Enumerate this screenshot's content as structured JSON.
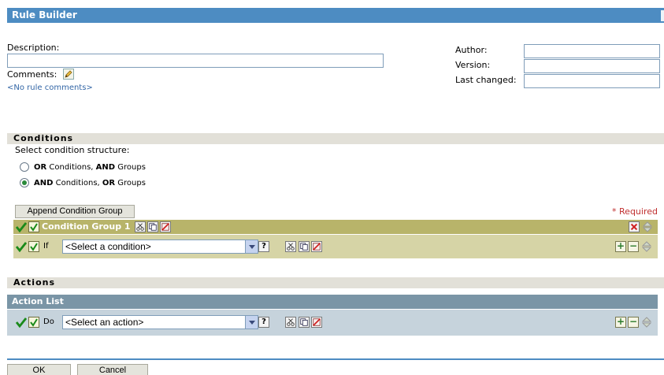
{
  "header": {
    "title": "Rule Builder"
  },
  "form": {
    "description_label": "Description:",
    "description_value": "",
    "comments_label": "Comments:",
    "comments_placeholder": "<No rule comments>",
    "author_label": "Author:",
    "author_value": "",
    "version_label": "Version:",
    "version_value": "",
    "last_changed_label": "Last changed:",
    "last_changed_value": ""
  },
  "conditions": {
    "section_title": "Conditions",
    "structure_label": "Select condition structure:",
    "options": [
      {
        "bold1": "OR",
        "mid": " Conditions, ",
        "bold2": "AND",
        "tail": " Groups",
        "selected": false
      },
      {
        "bold1": "AND",
        "mid": " Conditions, ",
        "bold2": "OR",
        "tail": " Groups",
        "selected": true
      }
    ],
    "append_button": "Append Condition Group",
    "required_note": "* Required",
    "group": {
      "title": "Condition Group 1",
      "row_keyword": "If",
      "select_value": "<Select a condition>",
      "help_label": "?"
    }
  },
  "actions": {
    "section_title": "Actions",
    "list_title": "Action List",
    "row_keyword": "Do",
    "select_value": "<Select an action>",
    "help_label": "?"
  },
  "footer": {
    "ok_label": "OK",
    "cancel_label": "Cancel"
  },
  "colors": {
    "title_bar": "#4d8cc2",
    "group_header": "#b8b46a",
    "group_row": "#d6d4a6",
    "action_header": "#7a95a6",
    "action_row": "#c6d3dc",
    "required": "#c03030"
  },
  "icons": [
    "check-icon",
    "toggle-icon",
    "cut-icon",
    "copy-icon",
    "delete-icon",
    "pencil-icon",
    "plus-icon",
    "minus-icon",
    "up-down-icon",
    "close-icon"
  ]
}
